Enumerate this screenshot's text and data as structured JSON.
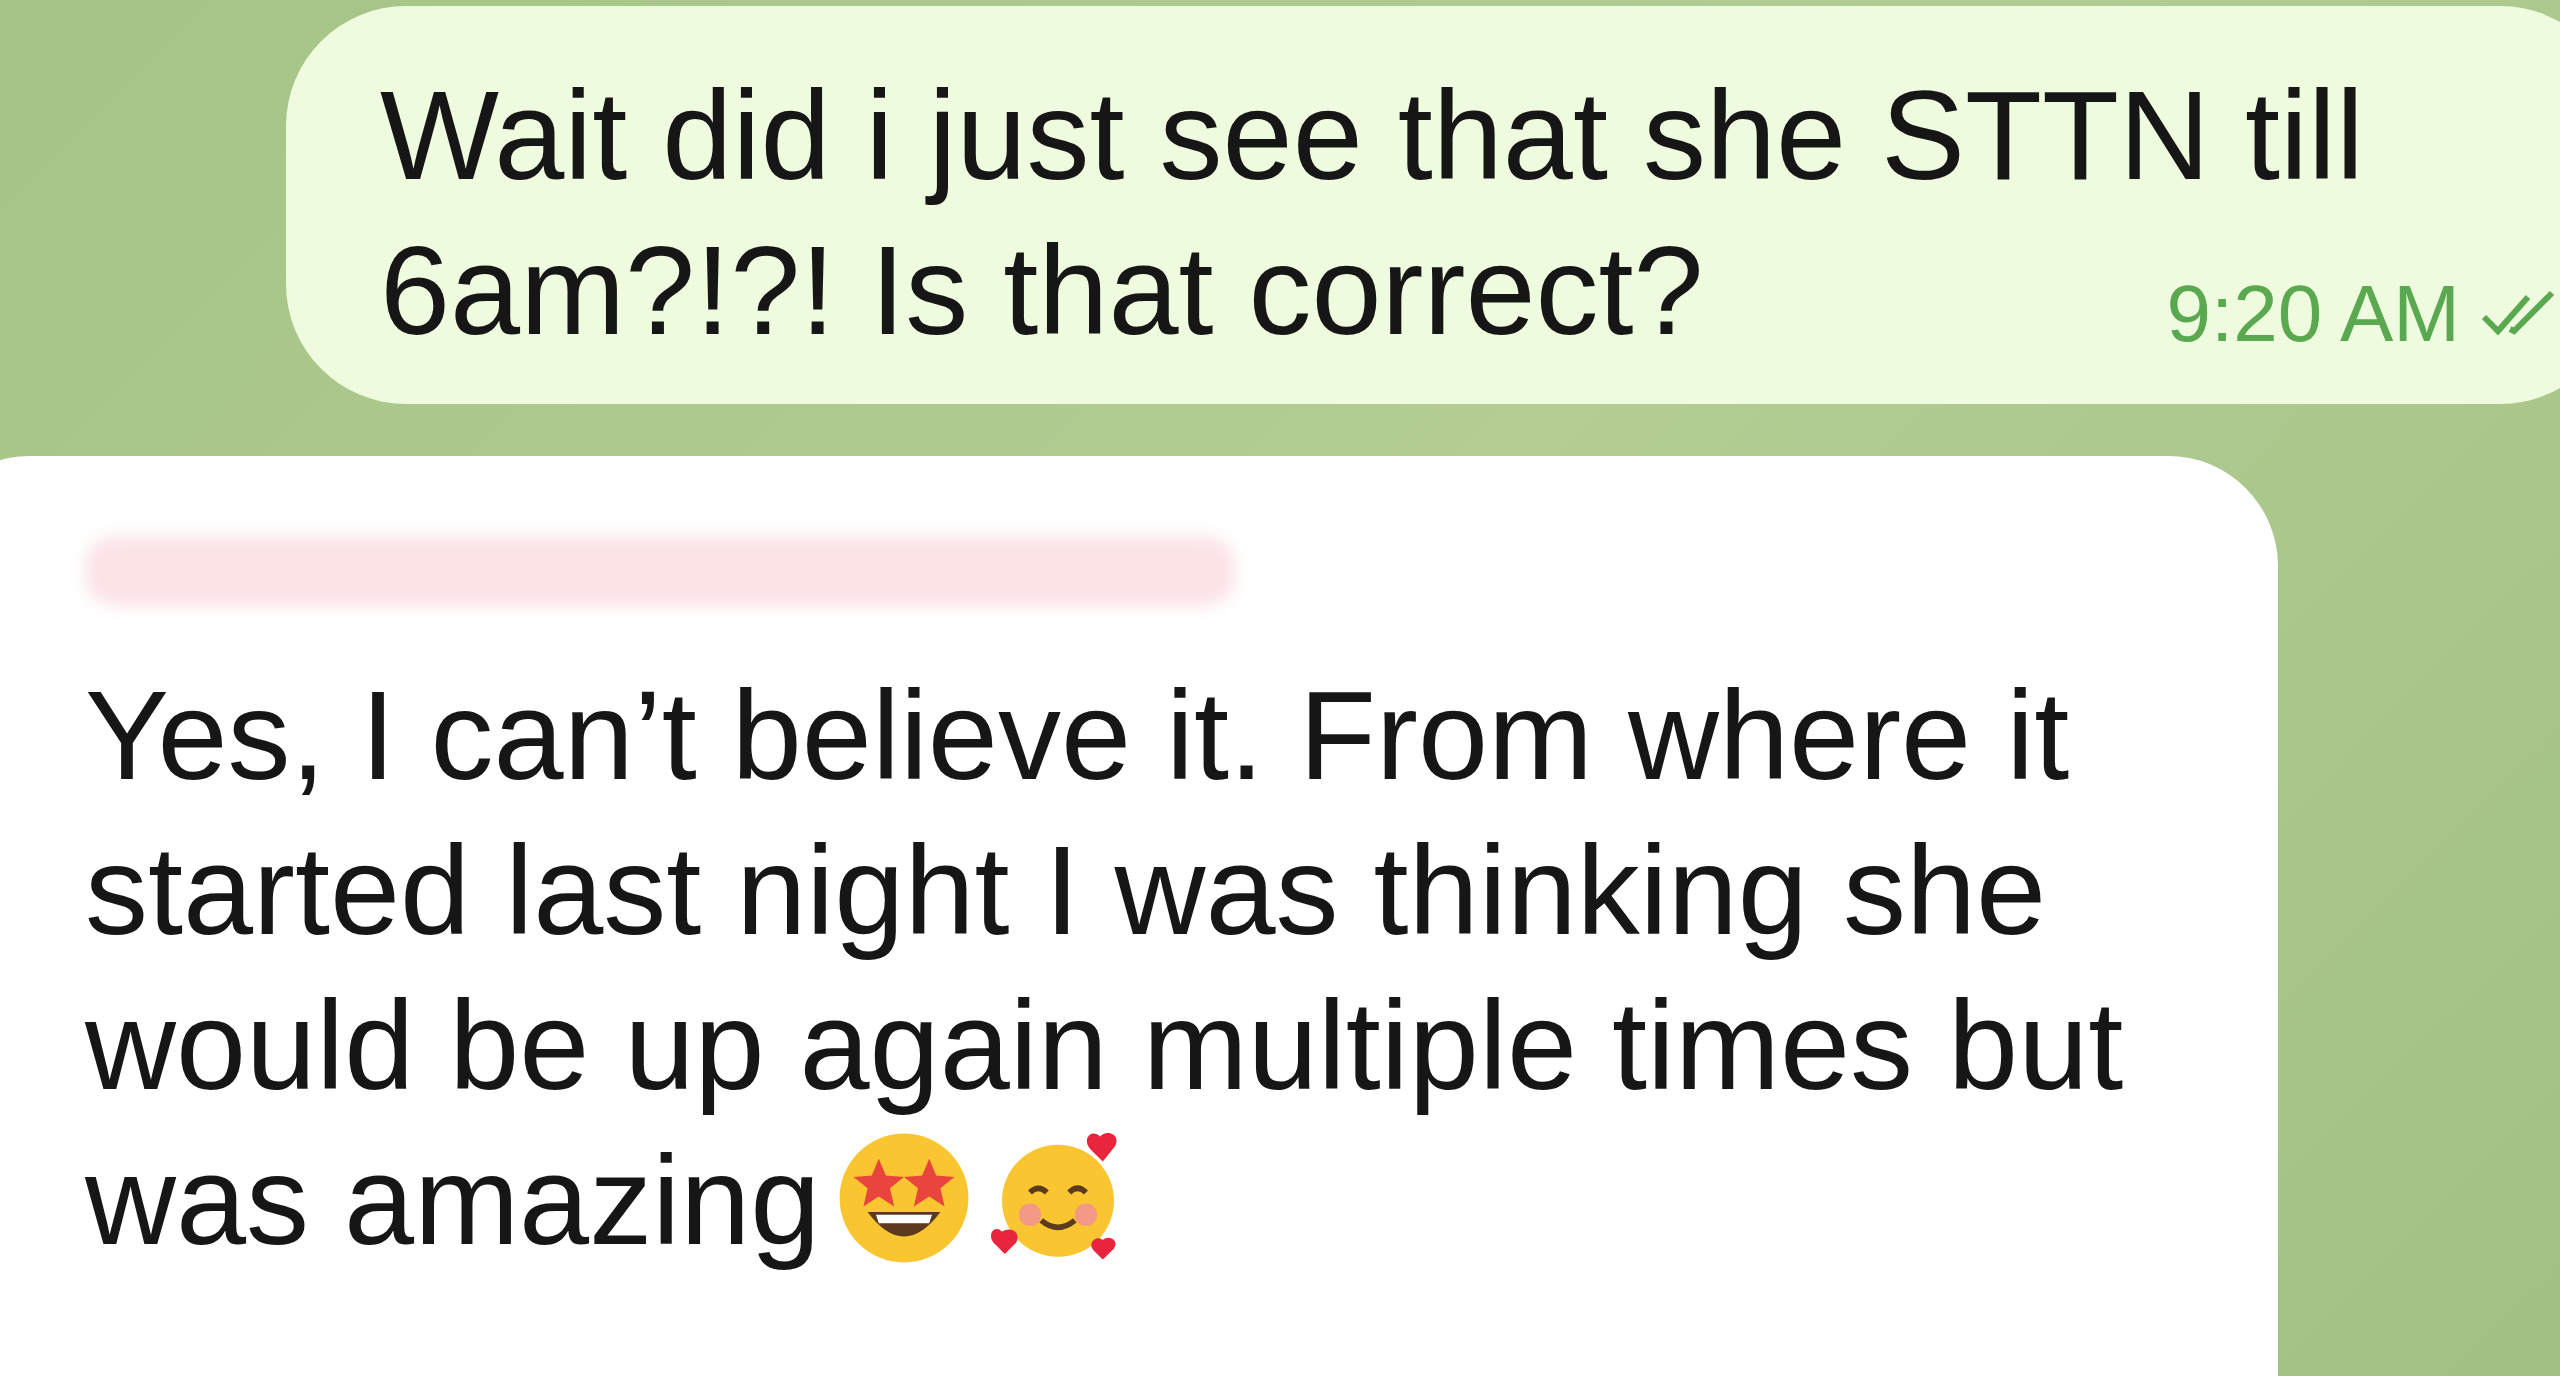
{
  "messages": [
    {
      "kind": "outgoing",
      "lines": [
        "Wait did i just see that she STTN till",
        "6am?!?! Is that correct?"
      ],
      "time": "9:20 AM",
      "read": true
    },
    {
      "kind": "incoming",
      "sender_redacted": true,
      "text": "Yes, I can’t believe it. From where it started last night I was thinking she would be up again multiple times but was amazing"
    }
  ]
}
